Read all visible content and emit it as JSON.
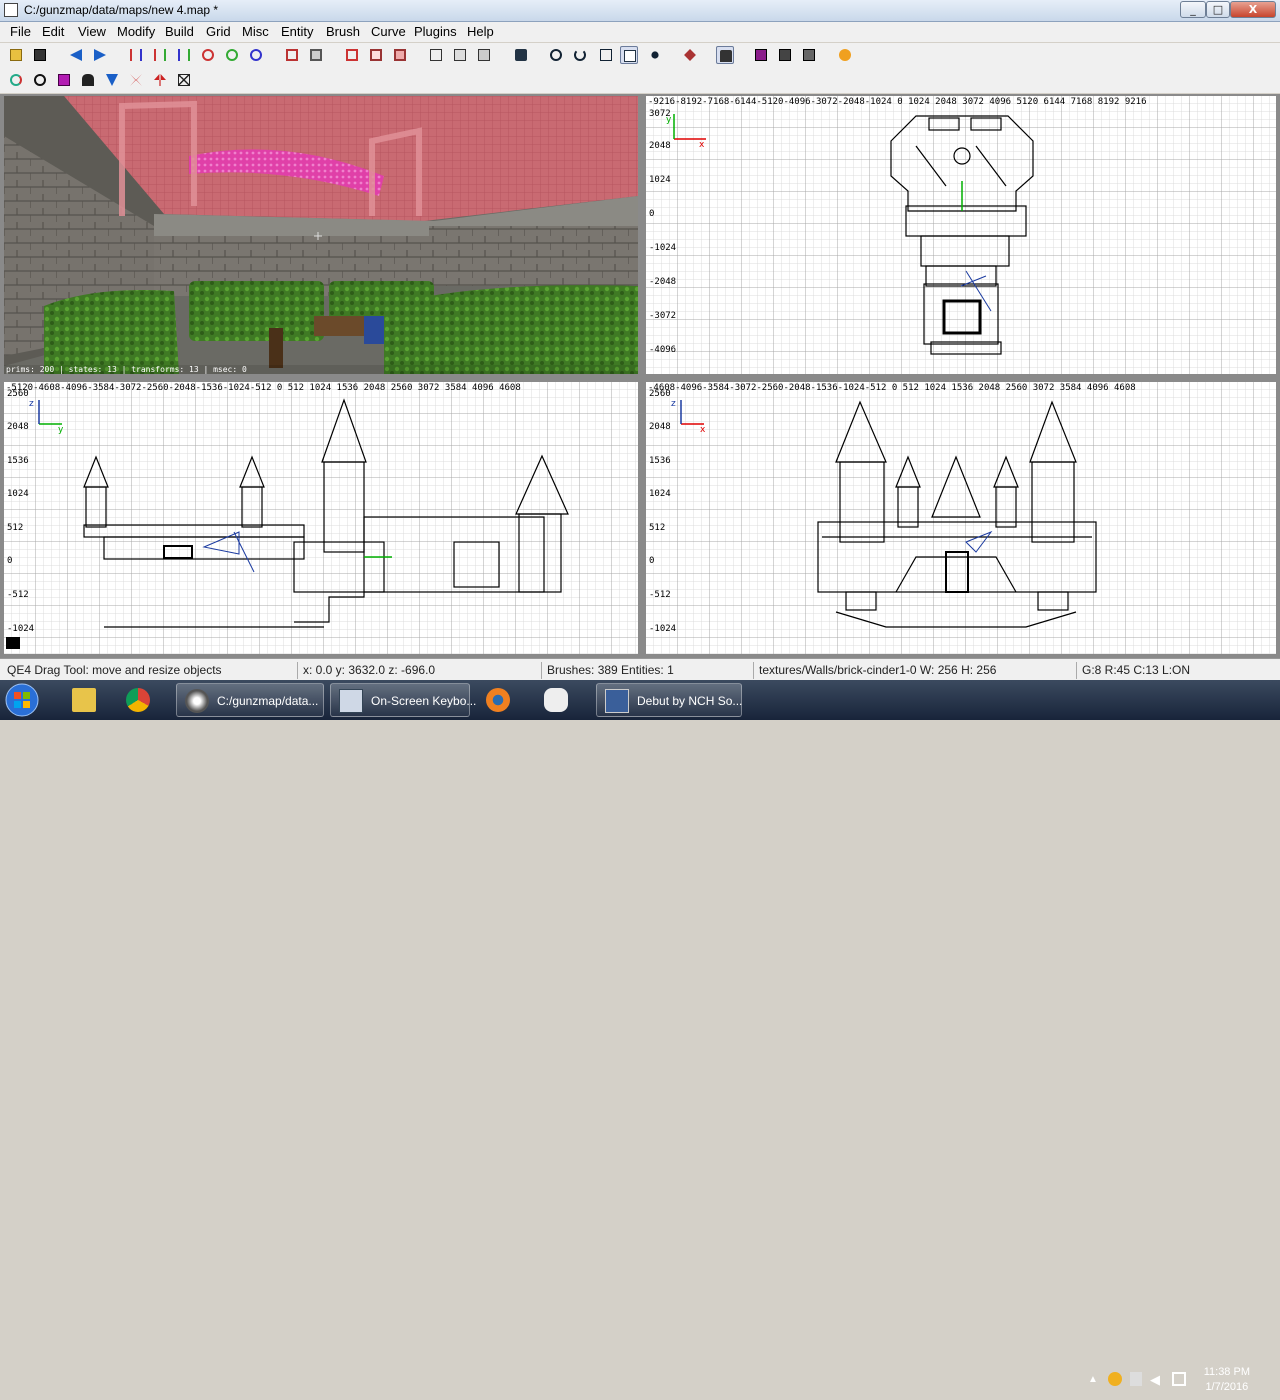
{
  "window": {
    "title": "C:/gunzmap/data/maps/new 4.map *",
    "min_label": "_",
    "max_label": "□",
    "close_label": "X"
  },
  "menu": [
    "File",
    "Edit",
    "View",
    "Modify",
    "Build",
    "Grid",
    "Misc",
    "Entity",
    "Brush",
    "Curve",
    "Plugins",
    "Help"
  ],
  "toolbar1": [
    "open-icon",
    "save-icon",
    "undo-icon",
    "redo-icon",
    "flip-x-icon",
    "flip-y-icon",
    "flip-z-icon",
    "rotate-x-icon",
    "rotate-y-icon",
    "rotate-z-icon",
    "hollow-icon",
    "csg-subtract-icon",
    "select-complete-icon",
    "select-touching-icon",
    "select-inside-icon",
    "view-change-icon",
    "cubic-clip-icon",
    "camera-icon",
    "move-icon",
    "rotate-icon",
    "scale-icon",
    "qe4-drag-icon",
    "vertex-icon",
    "edit-patch-icon",
    "lock-icon",
    "texture-icon",
    "shader-icon",
    "fullscreen-icon",
    "plugin-icon"
  ],
  "toolbar2": [
    "refresh-icon",
    "circle-icon",
    "entity-icon",
    "monster-icon",
    "down-arrow-icon",
    "flip-icon",
    "mirror-icon",
    "close-icon"
  ],
  "camera": {
    "stats": "prims: 200 | states: 13 | transforms: 13 | msec: 0"
  },
  "top_view": {
    "ruler": "-9216-8192-7168-6144-5120-4096-3072-2048-1024 0    1024 2048 3072 4096 5120 6144 7168 8192 9216",
    "y_labels": [
      "3072",
      "2048",
      "1024",
      "0",
      "-1024",
      "-2048",
      "-3072",
      "-4096"
    ],
    "axis_x": "x",
    "axis_y": "y"
  },
  "side_view": {
    "ruler": "-5120-4608-4096-3584-3072-2560-2048-1536-1024-512 0    512 1024 1536 2048 2560 3072 3584 4096 4608",
    "y_labels": [
      "2560",
      "2048",
      "1536",
      "1024",
      "512",
      "0",
      "-512",
      "-1024"
    ],
    "axis_x": "y",
    "axis_y": "z"
  },
  "front_view": {
    "ruler": "-4608-4096-3584-3072-2560-2048-1536-1024-512 0    512 1024 1536 2048 2560 3072 3584 4096 4608",
    "y_labels": [
      "2560",
      "2048",
      "1536",
      "1024",
      "512",
      "0",
      "-512",
      "-1024"
    ],
    "axis_x": "x",
    "axis_y": "z"
  },
  "status": {
    "tool": "QE4 Drag Tool: move and resize objects",
    "coords": "x:    0.0  y:  3632.0  z:  -696.0",
    "counts": "Brushes: 389 Entities: 1",
    "texture": "textures/Walls/brick-cinder1-0 W: 256 H: 256",
    "grid": "G:8  R:45  C:13  L:ON"
  },
  "taskbar": {
    "items": [
      {
        "label": "",
        "icon": "explorer-icon"
      },
      {
        "label": "",
        "icon": "chrome-icon"
      },
      {
        "label": "C:/gunzmap/data...",
        "icon": "gtkradiant-icon"
      },
      {
        "label": "On-Screen Keybo...",
        "icon": "keyboard-icon"
      },
      {
        "label": "",
        "icon": "blender-icon"
      },
      {
        "label": "",
        "icon": "gamepad-icon"
      },
      {
        "label": "Debut by NCH So...",
        "icon": "debut-icon"
      }
    ],
    "time": "11:38 PM",
    "date": "1/7/2016"
  },
  "colors": {
    "accent_blue": "#1a5fc7",
    "axis_red": "#e00000",
    "axis_green": "#00b000",
    "grid_minor": "#dcdcdc",
    "grid_major": "#a8a8a8"
  }
}
